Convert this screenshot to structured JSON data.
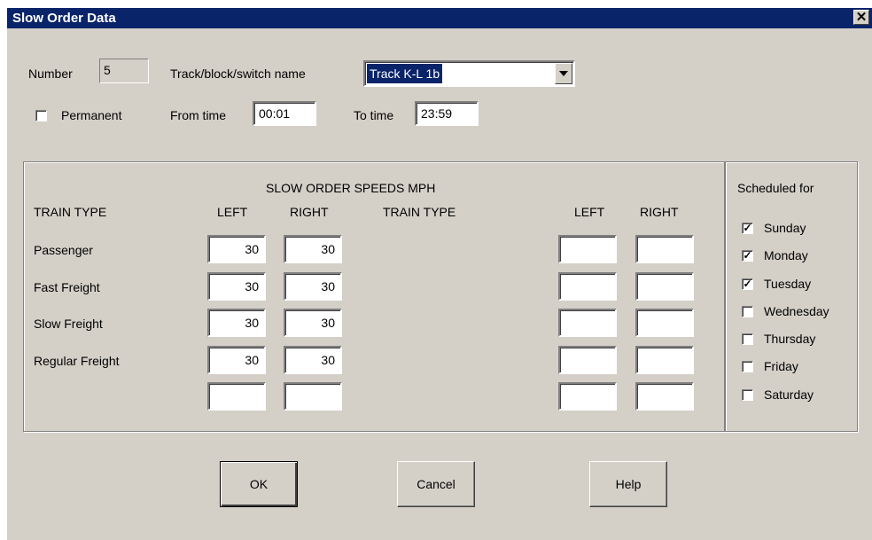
{
  "window": {
    "title": "Slow Order Data",
    "close_glyph": "✕"
  },
  "top": {
    "number_label": "Number",
    "number_value": "5",
    "track_label": "Track/block/switch name",
    "track_value": "Track K-L 1b",
    "permanent_label": "Permanent",
    "permanent_checked": false,
    "from_label": "From time",
    "from_value": "00:01",
    "to_label": "To time",
    "to_value": "23:59"
  },
  "speeds": {
    "heading": "SLOW ORDER SPEEDS MPH",
    "col_train_type": "TRAIN TYPE",
    "col_left": "LEFT",
    "col_right": "RIGHT",
    "left_rows": [
      {
        "name": "Passenger",
        "left": "30",
        "right": "30"
      },
      {
        "name": "Fast Freight",
        "left": "30",
        "right": "30"
      },
      {
        "name": "Slow Freight",
        "left": "30",
        "right": "30"
      },
      {
        "name": "Regular Freight",
        "left": "30",
        "right": "30"
      },
      {
        "name": "",
        "left": "",
        "right": ""
      }
    ],
    "right_rows": [
      {
        "name": "",
        "left": "",
        "right": ""
      },
      {
        "name": "",
        "left": "",
        "right": ""
      },
      {
        "name": "",
        "left": "",
        "right": ""
      },
      {
        "name": "",
        "left": "",
        "right": ""
      },
      {
        "name": "",
        "left": "",
        "right": ""
      }
    ]
  },
  "schedule": {
    "heading": "Scheduled for",
    "check_glyph": "✓",
    "days": [
      {
        "label": "Sunday",
        "checked": true
      },
      {
        "label": "Monday",
        "checked": true
      },
      {
        "label": "Tuesday",
        "checked": true
      },
      {
        "label": "Wednesday",
        "checked": false
      },
      {
        "label": "Thursday",
        "checked": false
      },
      {
        "label": "Friday",
        "checked": false
      },
      {
        "label": "Saturday",
        "checked": false
      }
    ]
  },
  "buttons": {
    "ok": "OK",
    "cancel": "Cancel",
    "help": "Help"
  },
  "colors": {
    "titlebar": "#0a246a",
    "face": "#d4d0c8",
    "selection": "#0a246a"
  },
  "icons": {
    "dropdown": "chevron-down-icon",
    "close": "close-icon",
    "checkbox": "checkmark-icon"
  }
}
